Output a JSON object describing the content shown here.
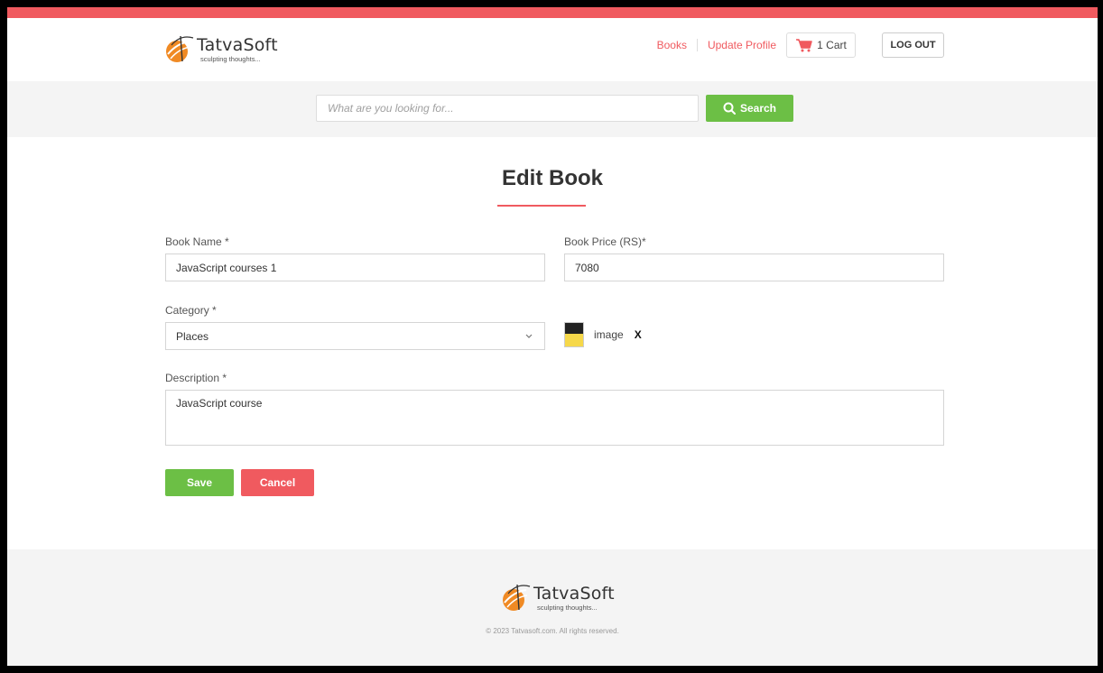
{
  "brand": {
    "name": "TatvaSoft",
    "tagline": "sculpting thoughts..."
  },
  "nav": {
    "books_label": "Books",
    "update_profile_label": "Update Profile",
    "cart_label": "1 Cart",
    "logout_label": "LOG OUT"
  },
  "search": {
    "placeholder": "What are you looking for...",
    "button_label": "Search"
  },
  "page": {
    "title": "Edit Book"
  },
  "form": {
    "book_name": {
      "label": "Book Name *",
      "value": "JavaScript courses 1"
    },
    "book_price": {
      "label": "Book Price (RS)*",
      "value": "7080"
    },
    "category": {
      "label": "Category *",
      "value": "Places"
    },
    "image": {
      "label": "image",
      "remove": "X"
    },
    "description": {
      "label": "Description *",
      "value": "JavaScript course"
    },
    "save_label": "Save",
    "cancel_label": "Cancel"
  },
  "footer": {
    "copyright": "© 2023 Tatvasoft.com. All rights reserved."
  },
  "colors": {
    "accent": "#f05a5f",
    "success": "#6cbf45",
    "band": "#f4f4f4"
  }
}
